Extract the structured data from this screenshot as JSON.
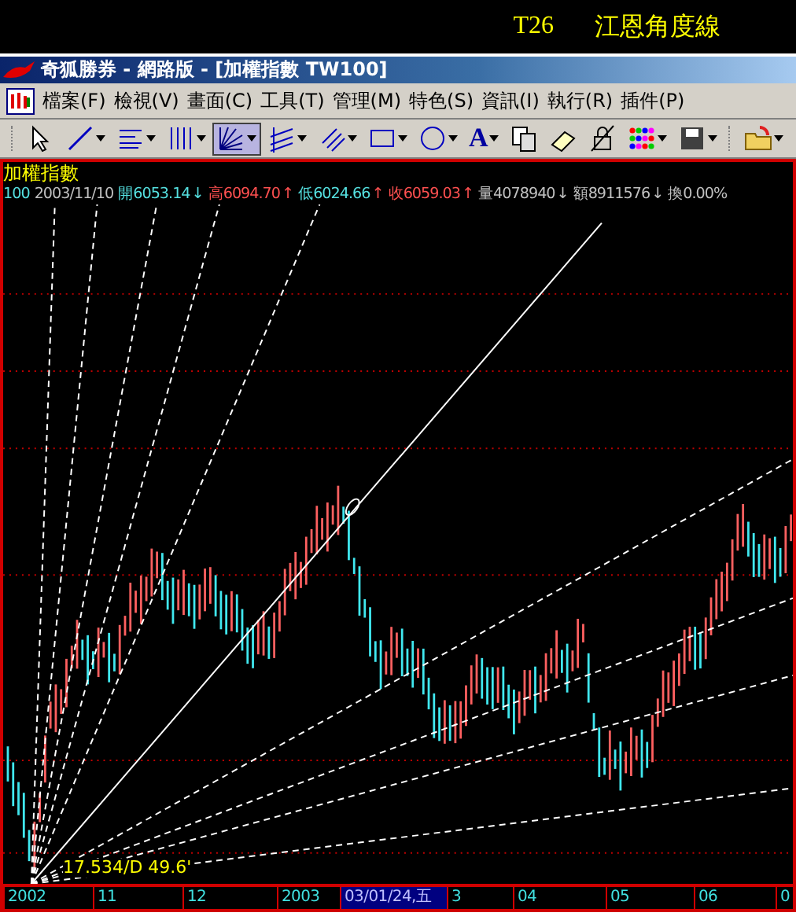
{
  "banner": {
    "code": "T26",
    "caption": "江恩角度線"
  },
  "window": {
    "title": "奇狐勝券 - 網路版 - [加權指數 TW100]"
  },
  "menu": [
    "檔案(F)",
    "檢視(V)",
    "畫面(C)",
    "工具(T)",
    "管理(M)",
    "特色(S)",
    "資訊(I)",
    "執行(R)",
    "插件(P)"
  ],
  "toolbar": [
    {
      "kind": "pointer",
      "dropdown": false,
      "selected": false
    },
    {
      "kind": "line",
      "dropdown": true,
      "selected": false
    },
    {
      "kind": "levels",
      "dropdown": true,
      "selected": false
    },
    {
      "kind": "vlines",
      "dropdown": true,
      "selected": false
    },
    {
      "kind": "fan",
      "dropdown": true,
      "selected": true
    },
    {
      "kind": "channel",
      "dropdown": true,
      "selected": false
    },
    {
      "kind": "hatch",
      "dropdown": true,
      "selected": false
    },
    {
      "kind": "rect",
      "dropdown": true,
      "selected": false
    },
    {
      "kind": "ellipse",
      "dropdown": true,
      "selected": false
    },
    {
      "kind": "text",
      "label": "A",
      "dropdown": true,
      "selected": false
    },
    {
      "kind": "copy",
      "dropdown": false,
      "selected": false
    },
    {
      "kind": "eraser",
      "dropdown": false,
      "selected": false
    },
    {
      "kind": "lock",
      "dropdown": false,
      "selected": false
    },
    {
      "kind": "colors",
      "dropdown": true,
      "selected": false
    },
    {
      "kind": "save",
      "dropdown": true,
      "selected": false
    },
    {
      "kind": "open",
      "dropdown": true,
      "selected": false
    }
  ],
  "chart": {
    "title": "加權指數",
    "stats": [
      {
        "text": "100",
        "color": "#55e0e0"
      },
      {
        "text": "2003/11/10",
        "color": "#c0c0c0"
      },
      {
        "text": "開6053.14",
        "color": "#55e0e0"
      },
      {
        "text": "↓",
        "color": "#55e0e0"
      },
      {
        "text": "高6094.70",
        "color": "#ff5050"
      },
      {
        "text": "↑",
        "color": "#ff5050"
      },
      {
        "text": "低6024.66",
        "color": "#55e0e0"
      },
      {
        "text": "↑",
        "color": "#ff5050"
      },
      {
        "text": "收6059.03",
        "color": "#ff5050"
      },
      {
        "text": "↑",
        "color": "#ff5050"
      },
      {
        "text": "量4078940",
        "color": "#c0c0c0"
      },
      {
        "text": "↓",
        "color": "#c0c0c0"
      },
      {
        "text": "額8911576",
        "color": "#c0c0c0"
      },
      {
        "text": "↓",
        "color": "#c0c0c0"
      },
      {
        "text": "換0.00%",
        "color": "#c0c0c0"
      }
    ],
    "annotation": "17.534/D 49.6'",
    "axis": [
      {
        "label": "2002",
        "selected": false
      },
      {
        "label": "11",
        "selected": false
      },
      {
        "label": "12",
        "selected": false
      },
      {
        "label": "2003",
        "selected": false
      },
      {
        "label": "03/01/24,五",
        "selected": true
      },
      {
        "label": "3",
        "selected": false
      },
      {
        "label": "04",
        "selected": false
      },
      {
        "label": "05",
        "selected": false
      },
      {
        "label": "06",
        "selected": false
      },
      {
        "label": "0",
        "selected": false
      }
    ]
  }
}
